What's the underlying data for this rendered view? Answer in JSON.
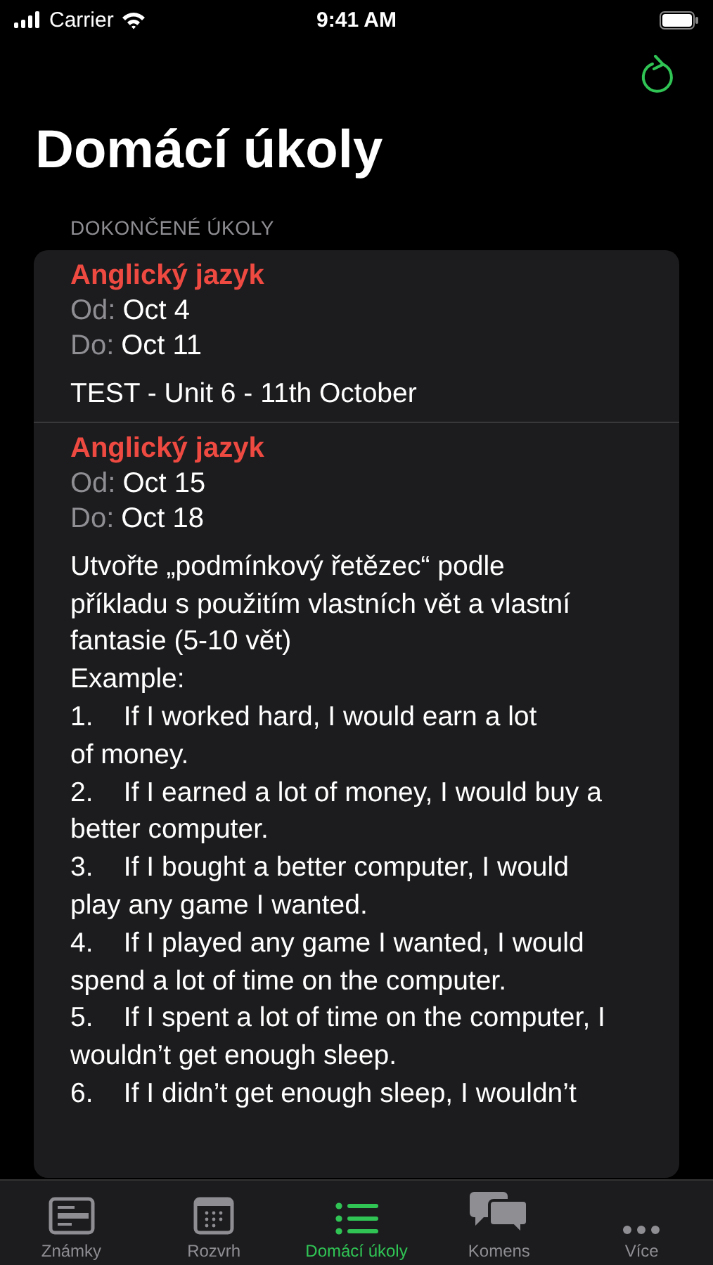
{
  "status_bar": {
    "carrier": "Carrier",
    "time": "9:41 AM"
  },
  "title": "Domácí úkoly",
  "section": {
    "header": "DOKONČENÉ ÚKOLY",
    "tasks": [
      {
        "subject": "Anglický jazyk",
        "from_label": "Od:",
        "from": "Oct 4",
        "to_label": "Do:",
        "to": "Oct 11",
        "description": [
          "TEST - Unit 6 - 11th October"
        ]
      },
      {
        "subject": "Anglický jazyk",
        "from_label": "Od:",
        "from": "Oct 15",
        "to_label": "Do:",
        "to": "Oct 18",
        "description": [
          "Utvořte „podmínkový řetězec“ podle",
          "příkladu s použitím vlastních vět a vlastní",
          "fantasie (5-10 vět)",
          "Example:",
          "1.    If I worked hard, I would earn a lot",
          "of money.",
          "2.    If I earned a lot of money, I would buy a",
          "better computer.",
          "3.    If I bought a better computer, I would",
          "play any game I wanted.",
          "4.    If I played any game I wanted, I would",
          "spend a lot of time on the computer.",
          "5.    If I spent a lot of time on the computer, I",
          "wouldn’t get enough sleep.",
          "6.    If I didn’t get enough sleep, I wouldn’t"
        ]
      }
    ]
  },
  "tab_bar": [
    {
      "label": "Známky",
      "selected": false
    },
    {
      "label": "Rozvrh",
      "selected": false
    },
    {
      "label": "Domácí úkoly",
      "selected": true
    },
    {
      "label": "Komens",
      "selected": false
    },
    {
      "label": "Více",
      "selected": false
    }
  ]
}
